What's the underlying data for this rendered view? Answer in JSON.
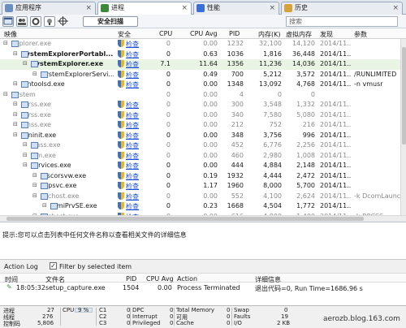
{
  "tabs": [
    {
      "label": "应用程序",
      "icon": "apps-icon",
      "color": "#6a8fc0",
      "active": false
    },
    {
      "label": "进程",
      "icon": "processes-icon",
      "color": "#3b8a3b",
      "active": true
    },
    {
      "label": "性能",
      "icon": "performance-icon",
      "color": "#3b6fd6",
      "active": false
    },
    {
      "label": "历史",
      "icon": "history-icon",
      "color": "#d6a23b",
      "active": false
    }
  ],
  "toolbar": {
    "scan_label": "安全扫描",
    "search_placeholder": "搜索"
  },
  "columns": {
    "name": "映像",
    "security": "安全",
    "cpu": "CPU",
    "cpu_avg": "CPU Avg",
    "pid": "PID",
    "memory": "内存(K)",
    "virtual_memory": "虚拟内存",
    "start": "发现",
    "args": "参数"
  },
  "processes": [
    {
      "name": "explorer.exe",
      "sec": "检查",
      "cpu": "0",
      "avg": "0.00",
      "pid": "1232",
      "mem": "32,100",
      "vmem": "14,120",
      "start": "2014/11...",
      "args": "",
      "indent": 0,
      "grey": true,
      "bold": false
    },
    {
      "name": "SystemExplorerPortabl...",
      "sec": "检查",
      "cpu": "0",
      "avg": "0.63",
      "pid": "1036",
      "mem": "1,816",
      "vmem": "36,448",
      "start": "2014/11...",
      "args": "",
      "indent": 1,
      "grey": false,
      "bold": true
    },
    {
      "name": "SystemExplorer.exe",
      "sec": "检查",
      "cpu": "7.1",
      "avg": "11.64",
      "pid": "1356",
      "mem": "11,236",
      "vmem": "14,036",
      "start": "2014/11...",
      "args": "",
      "indent": 2,
      "grey": false,
      "bold": true
    },
    {
      "name": "SystemExplorerServi...",
      "sec": "检查",
      "cpu": "0",
      "avg": "0.49",
      "pid": "700",
      "mem": "5,212",
      "vmem": "3,572",
      "start": "2014/11...",
      "args": "/RUNLIMITED",
      "indent": 3,
      "grey": false,
      "bold": false
    },
    {
      "name": "vmtoolsd.exe",
      "sec": "检查",
      "cpu": "0",
      "avg": "0.00",
      "pid": "1348",
      "mem": "13,092",
      "vmem": "4,768",
      "start": "2014/11...",
      "args": "-n vmusr",
      "indent": 1,
      "grey": false,
      "bold": false
    },
    {
      "name": "System",
      "sec": "",
      "cpu": "0",
      "avg": "0.00",
      "pid": "4",
      "mem": "0",
      "vmem": "0",
      "start": "",
      "args": "",
      "indent": 0,
      "grey": true,
      "bold": false
    },
    {
      "name": "csrss.exe",
      "sec": "检查",
      "cpu": "0",
      "avg": "0.00",
      "pid": "300",
      "mem": "3,548",
      "vmem": "1,332",
      "start": "2014/11...",
      "args": "",
      "indent": 1,
      "grey": true,
      "bold": false
    },
    {
      "name": "csrss.exe",
      "sec": "检查",
      "cpu": "0",
      "avg": "0.00",
      "pid": "340",
      "mem": "7,580",
      "vmem": "5,080",
      "start": "2014/11...",
      "args": "",
      "indent": 1,
      "grey": true,
      "bold": false
    },
    {
      "name": "smss.exe",
      "sec": "检查",
      "cpu": "0",
      "avg": "0.00",
      "pid": "212",
      "mem": "752",
      "vmem": "216",
      "start": "2014/11...",
      "args": "",
      "indent": 1,
      "grey": true,
      "bold": false
    },
    {
      "name": "wininit.exe",
      "sec": "检查",
      "cpu": "0",
      "avg": "0.00",
      "pid": "348",
      "mem": "3,756",
      "vmem": "996",
      "start": "2014/11...",
      "args": "",
      "indent": 1,
      "grey": false,
      "bold": false
    },
    {
      "name": "lsass.exe",
      "sec": "检查",
      "cpu": "0",
      "avg": "0.00",
      "pid": "452",
      "mem": "6,776",
      "vmem": "2,256",
      "start": "2014/11...",
      "args": "",
      "indent": 2,
      "grey": true,
      "bold": false
    },
    {
      "name": "lsm.exe",
      "sec": "检查",
      "cpu": "0",
      "avg": "0.00",
      "pid": "460",
      "mem": "2,980",
      "vmem": "1,008",
      "start": "2014/11...",
      "args": "",
      "indent": 2,
      "grey": true,
      "bold": false
    },
    {
      "name": "services.exe",
      "sec": "检查",
      "cpu": "0",
      "avg": "0.00",
      "pid": "444",
      "mem": "4,884",
      "vmem": "2,148",
      "start": "2014/11...",
      "args": "",
      "indent": 2,
      "grey": false,
      "bold": false
    },
    {
      "name": "mscorsvw.exe",
      "sec": "检查",
      "cpu": "0",
      "avg": "0.19",
      "pid": "1932",
      "mem": "4,444",
      "vmem": "2,472",
      "start": "2014/11...",
      "args": "",
      "indent": 3,
      "grey": false,
      "bold": false
    },
    {
      "name": "sppsvc.exe",
      "sec": "检查",
      "cpu": "0",
      "avg": "1.17",
      "pid": "1960",
      "mem": "8,000",
      "vmem": "5,700",
      "start": "2014/11...",
      "args": "",
      "indent": 3,
      "grey": false,
      "bold": false
    },
    {
      "name": "svchost.exe",
      "sec": "检查",
      "cpu": "0",
      "avg": "0.00",
      "pid": "552",
      "mem": "4,100",
      "vmem": "2,624",
      "start": "2014/11...",
      "args": "-k DcomLaunch",
      "indent": 3,
      "grey": true,
      "bold": false
    },
    {
      "name": "WmiPrvSE.exe",
      "sec": "检查",
      "cpu": "0",
      "avg": "0.23",
      "pid": "1668",
      "mem": "4,504",
      "vmem": "1,772",
      "start": "2014/11...",
      "args": "",
      "indent": 4,
      "grey": false,
      "bold": false
    },
    {
      "name": "svchost.exe",
      "sec": "检查",
      "cpu": "0",
      "avg": "0.00",
      "pid": "616",
      "mem": "4,800",
      "vmem": "1,400",
      "start": "2014/11...",
      "args": "-k RPCSS",
      "indent": 3,
      "grey": true,
      "bold": false
    }
  ],
  "info_text": "提示:您可以点击列表中任何文件名称以查看相关文件的详细信息",
  "action_log": {
    "title": "Action Log",
    "filter_label": "Filter by selected item",
    "columns": {
      "time": "时间",
      "file": "文件名",
      "pid": "PID",
      "cpu_avg": "CPU Avg",
      "action": "Action",
      "details": "详细信息"
    },
    "rows": [
      {
        "time": "18:05:32",
        "file": "setup_capture.exe",
        "pid": "1504",
        "cpu_avg": "0.00",
        "action": "Process Terminated",
        "details": "退出代码=0, Run Time=1686.96 s"
      }
    ]
  },
  "status": {
    "processes_label": "进程",
    "processes_value": "27",
    "threads_label": "线程",
    "threads_value": "276",
    "handles_label": "控制码",
    "handles_value": "5,806",
    "cpu_label": "CPU",
    "cpu_value": "9 %",
    "c1_label": "C1",
    "c1_value": "0",
    "c2_label": "C2",
    "c2_value": "0",
    "c3_label": "C3",
    "c3_value": "0",
    "dpc_label": "DPC",
    "dpc_value": "0",
    "interrupt_label": "Interrupt",
    "interrupt_value": "0",
    "privileged_label": "Privileged",
    "privileged_value": "0",
    "total_mem_label": "Total Memory",
    "total_mem_value": "0",
    "avail_label": "可用",
    "avail_value": "0",
    "cache_label": "Cache",
    "cache_value": "0",
    "swap_label": "Swap",
    "swap_value": "0",
    "faults_label": "Faults",
    "faults_value": "19",
    "io_label": "I/O",
    "io_value": "2 KB"
  },
  "watermark": "aerozb.blog.163.com"
}
